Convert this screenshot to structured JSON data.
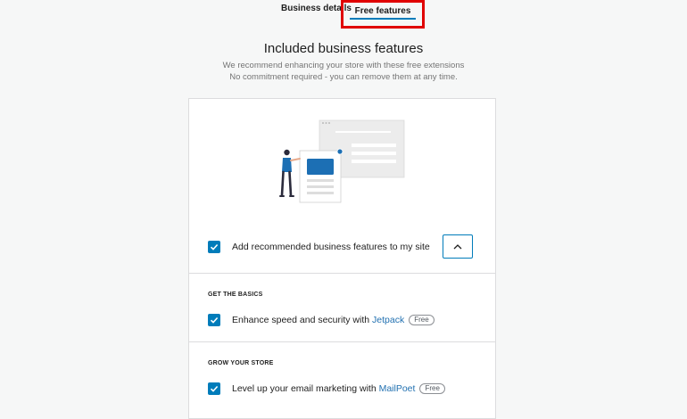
{
  "tabs": {
    "business_details": "Business details",
    "free_features": "Free features"
  },
  "header": {
    "title": "Included business features",
    "subtitle_line1": "We recommend enhancing your store with these free extensions",
    "subtitle_line2": "No commitment required - you can remove them at any time."
  },
  "main_option": {
    "label": "Add recommended business features to my site",
    "checked": true
  },
  "sections": [
    {
      "title": "GET THE BASICS",
      "item": {
        "prefix": "Enhance speed and security with ",
        "link": "Jetpack",
        "badge": "Free",
        "checked": true
      }
    },
    {
      "title": "GROW YOUR STORE",
      "item": {
        "prefix": "Level up your email marketing with ",
        "link": "MailPoet",
        "badge": "Free",
        "checked": true
      }
    }
  ],
  "colors": {
    "accent": "#007cba",
    "highlight_border": "#e00000",
    "link": "#2271b1"
  }
}
